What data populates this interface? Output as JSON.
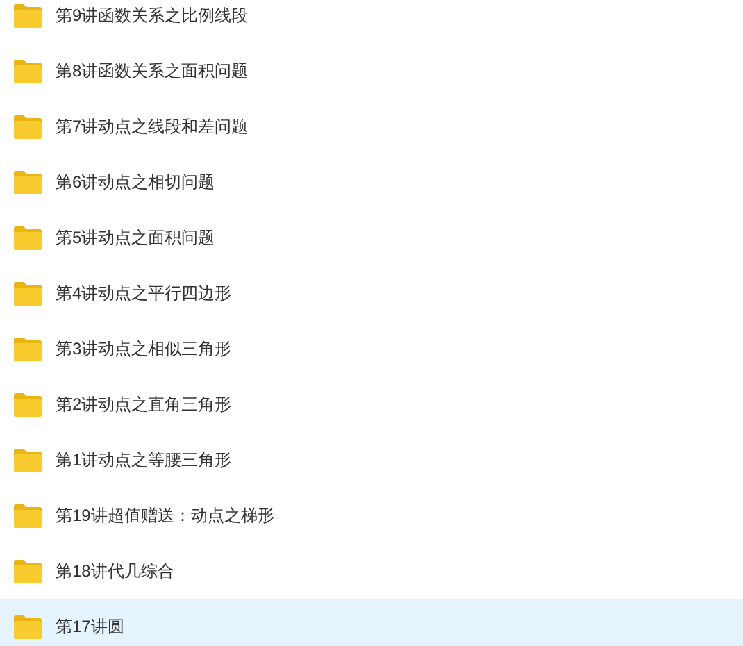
{
  "folders": [
    {
      "name": "第9讲函数关系之比例线段",
      "selected": false
    },
    {
      "name": "第8讲函数关系之面积问题",
      "selected": false
    },
    {
      "name": "第7讲动点之线段和差问题",
      "selected": false
    },
    {
      "name": "第6讲动点之相切问题",
      "selected": false
    },
    {
      "name": "第5讲动点之面积问题",
      "selected": false
    },
    {
      "name": "第4讲动点之平行四边形",
      "selected": false
    },
    {
      "name": "第3讲动点之相似三角形",
      "selected": false
    },
    {
      "name": "第2讲动点之直角三角形",
      "selected": false
    },
    {
      "name": "第1讲动点之等腰三角形",
      "selected": false
    },
    {
      "name": "第19讲超值赠送：动点之梯形",
      "selected": false
    },
    {
      "name": "第18讲代几综合",
      "selected": false
    },
    {
      "name": "第17讲圆",
      "selected": true
    }
  ]
}
